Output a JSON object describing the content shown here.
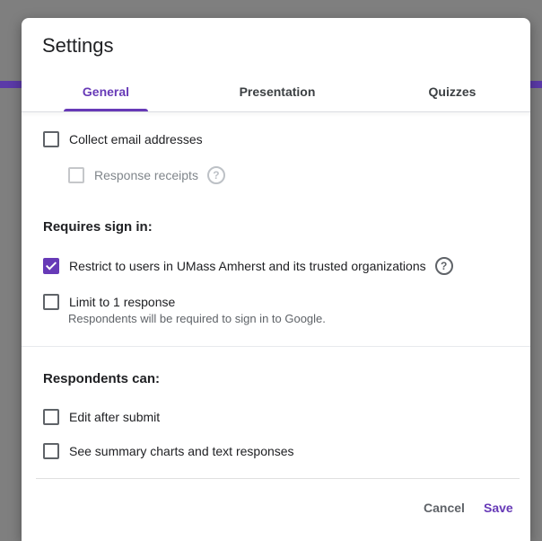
{
  "dialog": {
    "title": "Settings"
  },
  "tabs": [
    {
      "label": "General",
      "active": true
    },
    {
      "label": "Presentation",
      "active": false
    },
    {
      "label": "Quizzes",
      "active": false
    }
  ],
  "general": {
    "collect_email": {
      "label": "Collect email addresses",
      "checked": false
    },
    "response_receipts": {
      "label": "Response receipts",
      "checked": false,
      "disabled": true
    },
    "requires_sign_in_heading": "Requires sign in:",
    "restrict_users": {
      "label": "Restrict to users in UMass Amherst and its trusted organizations",
      "checked": true
    },
    "limit_one": {
      "label": "Limit to 1 response",
      "checked": false,
      "subtext": "Respondents will be required to sign in to Google."
    },
    "respondents_can_heading": "Respondents can:",
    "edit_after_submit": {
      "label": "Edit after submit",
      "checked": false
    },
    "see_summary": {
      "label": "See summary charts and text responses",
      "checked": false
    }
  },
  "footer": {
    "cancel_label": "Cancel",
    "save_label": "Save"
  },
  "colors": {
    "accent": "#673ab7",
    "text": "#202124",
    "muted": "#5f6368"
  },
  "icons": {
    "help": "help-circle-icon",
    "check": "checkmark-icon"
  }
}
